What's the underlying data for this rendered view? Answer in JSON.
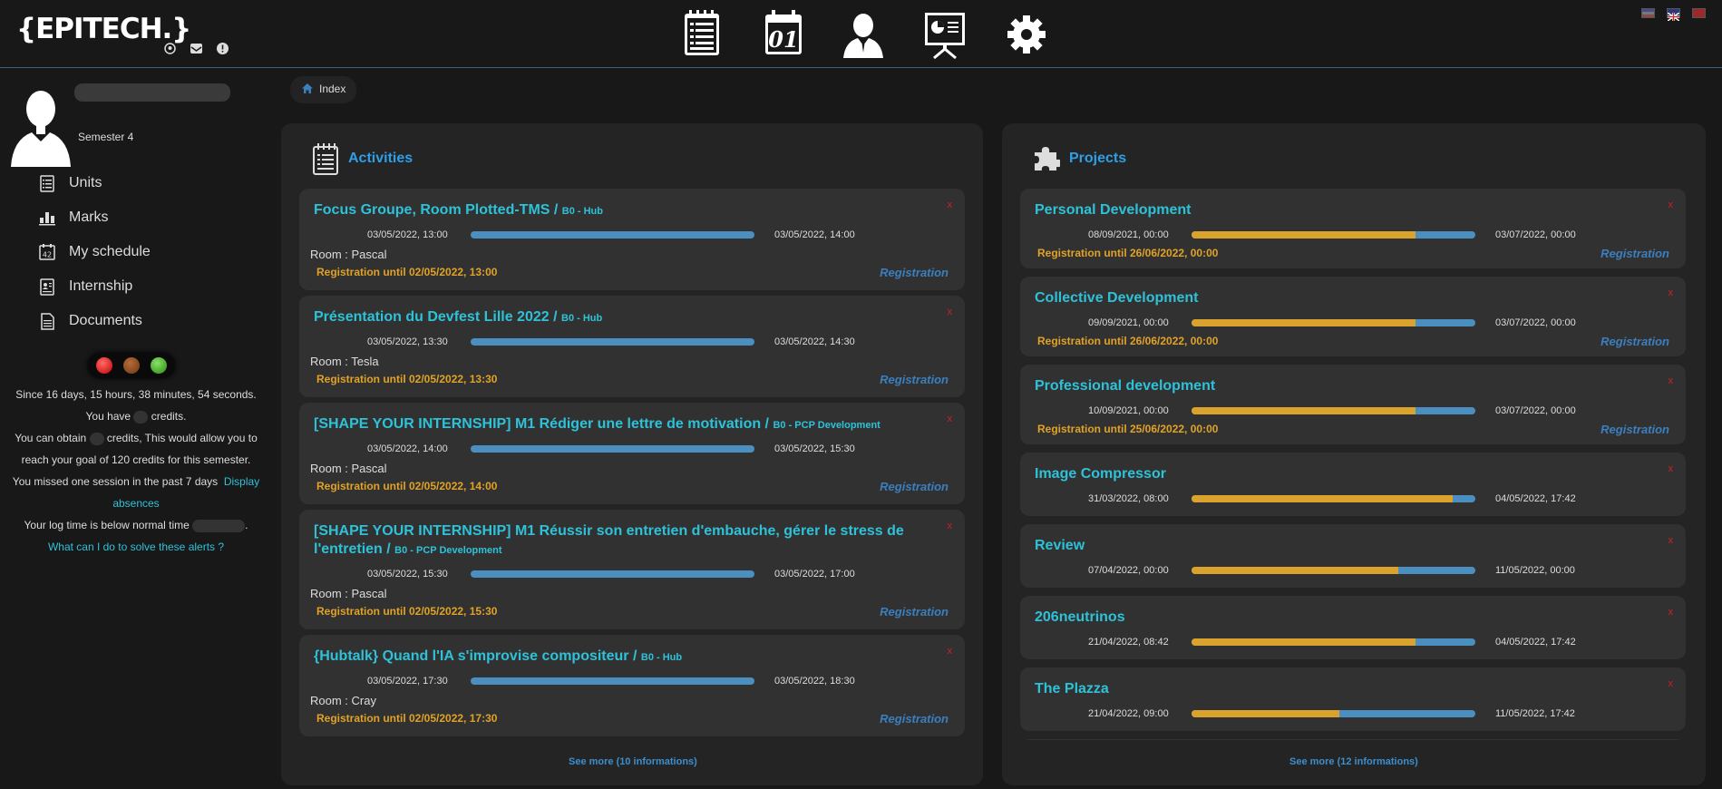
{
  "header": {
    "logo": "{EPITECH.}"
  },
  "breadcrumb": {
    "label": "Index"
  },
  "profile": {
    "semester": "Semester 4"
  },
  "menu": [
    {
      "label": "Units",
      "icon": "units-icon"
    },
    {
      "label": "Marks",
      "icon": "marks-icon"
    },
    {
      "label": "My schedule",
      "icon": "schedule-icon"
    },
    {
      "label": "Internship",
      "icon": "internship-icon"
    },
    {
      "label": "Documents",
      "icon": "documents-icon"
    }
  ],
  "alerts": {
    "since": "Since 16 days, 15 hours, 38 minutes, 54 seconds.",
    "have_pre": "You have",
    "have_post": "credits.",
    "obtain_pre": "You can obtain",
    "obtain_post": "credits, This would allow you to",
    "goal": "reach your goal of 120 credits for this semester.",
    "missed": "You missed one session in the past 7 days",
    "display": "Display",
    "absences": "absences",
    "logtime": "Your log time is below normal time",
    "logtime_end": ".",
    "solve": "What can I do to solve these alerts ?"
  },
  "activities": {
    "title": "Activities",
    "see_more": "See more (10 informations)",
    "items": [
      {
        "title": "Focus Groupe, Room Plotted-TMS",
        "module": "B0 - Hub",
        "start": "03/05/2022, 13:00",
        "end": "03/05/2022, 14:00",
        "room": "Room : Pascal",
        "reg": "Registration until 02/05/2022, 13:00",
        "btn": "Registration",
        "x": "x"
      },
      {
        "title": "Présentation du Devfest Lille 2022",
        "module": "B0 - Hub",
        "start": "03/05/2022, 13:30",
        "end": "03/05/2022, 14:30",
        "room": "Room : Tesla",
        "reg": "Registration until 02/05/2022, 13:30",
        "btn": "Registration",
        "x": "x"
      },
      {
        "title": "[SHAPE YOUR INTERNSHIP] M1 Rédiger une lettre de motivation",
        "module": "B0 - PCP Development",
        "start": "03/05/2022, 14:00",
        "end": "03/05/2022, 15:30",
        "room": "Room : Pascal",
        "reg": "Registration until 02/05/2022, 14:00",
        "btn": "Registration",
        "x": "x"
      },
      {
        "title": "[SHAPE YOUR INTERNSHIP] M1 Réussir son entretien d'embauche, gérer le stress de l'entretien",
        "module": "B0 - PCP Development",
        "start": "03/05/2022, 15:30",
        "end": "03/05/2022, 17:00",
        "room": "Room : Pascal",
        "reg": "Registration until 02/05/2022, 15:30",
        "btn": "Registration",
        "x": "x"
      },
      {
        "title": "{Hubtalk} Quand l'IA s'improvise compositeur",
        "module": "B0 - Hub",
        "start": "03/05/2022, 17:30",
        "end": "03/05/2022, 18:30",
        "room": "Room : Cray",
        "reg": "Registration until 02/05/2022, 17:30",
        "btn": "Registration",
        "x": "x"
      }
    ]
  },
  "projects": {
    "title": "Projects",
    "see_more": "See more (12 informations)",
    "items": [
      {
        "title": "Personal Development",
        "start": "08/09/2021, 00:00",
        "end": "03/07/2022, 00:00",
        "progress": 0.79,
        "reg": "Registration until 26/06/2022, 00:00",
        "btn": "Registration",
        "x": "x"
      },
      {
        "title": "Collective Development",
        "start": "09/09/2021, 00:00",
        "end": "03/07/2022, 00:00",
        "progress": 0.79,
        "reg": "Registration until 26/06/2022, 00:00",
        "btn": "Registration",
        "x": "x"
      },
      {
        "title": "Professional development",
        "start": "10/09/2021, 00:00",
        "end": "03/07/2022, 00:00",
        "progress": 0.79,
        "reg": "Registration until 25/06/2022, 00:00",
        "btn": "Registration",
        "x": "x"
      },
      {
        "title": "Image Compressor",
        "start": "31/03/2022, 08:00",
        "end": "04/05/2022, 17:42",
        "progress": 0.92,
        "x": "x"
      },
      {
        "title": "Review",
        "start": "07/04/2022, 00:00",
        "end": "11/05/2022, 00:00",
        "progress": 0.73,
        "x": "x"
      },
      {
        "title": "206neutrinos",
        "start": "21/04/2022, 08:42",
        "end": "04/05/2022, 17:42",
        "progress": 0.79,
        "x": "x"
      },
      {
        "title": "The Plazza",
        "start": "21/04/2022, 09:00",
        "end": "11/05/2022, 17:42",
        "progress": 0.52,
        "x": "x"
      }
    ]
  },
  "colors": {
    "accent": "#2ec2d9",
    "progress_done": "#d9a32e",
    "progress_rest": "#4a8fbf",
    "registration": "#e0a227"
  }
}
